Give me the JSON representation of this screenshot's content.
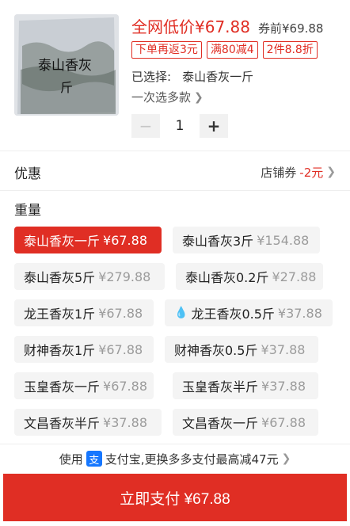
{
  "product": {
    "thumb_text": "泰山香灰",
    "price_label": "全网低价¥67.88",
    "before_coupon": "券前¥69.88",
    "tags": [
      "下单再返3元",
      "满80减4",
      "2件8.8折"
    ],
    "selected_label": "已选择:",
    "selected_value": "泰山香灰一斤",
    "multi_select": "一次选多款",
    "quantity": "1",
    "minus": "−",
    "plus": "+"
  },
  "coupon": {
    "title": "优惠",
    "store_label": "店铺券",
    "amount": "-2元"
  },
  "weight": {
    "title": "重量",
    "options": [
      {
        "name": "泰山香灰一斤",
        "price": "¥67.88",
        "active": true
      },
      {
        "name": "泰山香灰3斤",
        "price": "¥154.88"
      },
      {
        "name": "泰山香灰5斤",
        "price": "¥279.88"
      },
      {
        "name": "泰山香灰0.2斤",
        "price": "¥27.88"
      },
      {
        "name": "龙王香灰1斤",
        "price": "¥67.88"
      },
      {
        "name": "龙王香灰0.5斤",
        "price": "¥37.88",
        "hot": true
      },
      {
        "name": "财神香灰1斤",
        "price": "¥67.88"
      },
      {
        "name": "财神香灰0.5斤",
        "price": "¥37.88"
      },
      {
        "name": "玉皇香灰一斤",
        "price": "¥67.88"
      },
      {
        "name": "玉皇香灰半斤",
        "price": "¥37.88"
      },
      {
        "name": "文昌香灰半斤",
        "price": "¥37.88"
      },
      {
        "name": "文昌香灰一斤",
        "price": "¥67.88"
      }
    ]
  },
  "payment": {
    "use_label": "使用",
    "alipay_icon": "支",
    "alipay_name": "支付宝",
    "promo": ",更换多多支付最高减47元",
    "pay_button": "立即支付 ¥67.88"
  },
  "colors": {
    "accent": "#e02e24",
    "alipay": "#1677ff"
  }
}
